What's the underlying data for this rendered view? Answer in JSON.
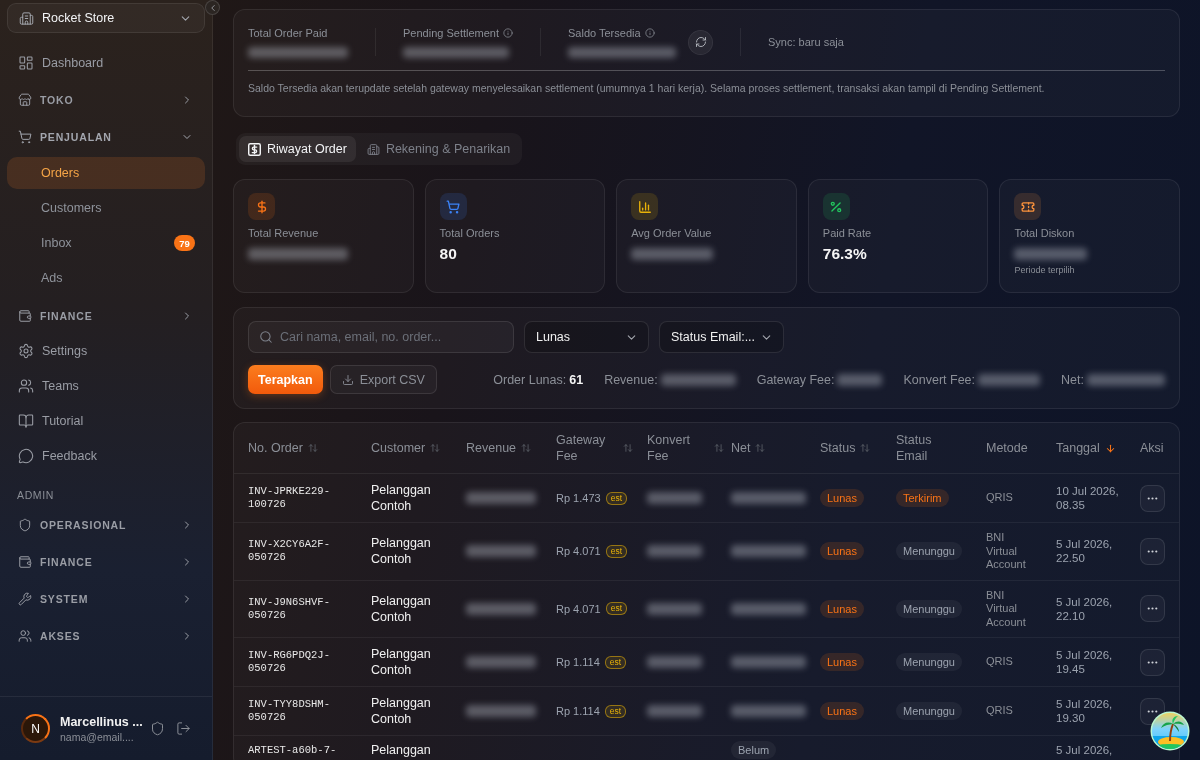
{
  "sidebar": {
    "store": {
      "name": "Rocket Store"
    },
    "items": [
      {
        "kind": "link",
        "label": "Dashboard",
        "selected": false
      },
      {
        "kind": "group",
        "label": "TOKO",
        "expanded": false
      },
      {
        "kind": "group",
        "label": "PENJUALAN",
        "expanded": true,
        "children": [
          {
            "label": "Orders",
            "selected": true
          },
          {
            "label": "Customers",
            "selected": false
          },
          {
            "label": "Inbox",
            "selected": false,
            "badge": "79"
          },
          {
            "label": "Ads",
            "selected": false
          }
        ]
      },
      {
        "kind": "group",
        "label": "FINANCE",
        "expanded": false
      },
      {
        "kind": "link",
        "label": "Settings",
        "selected": false
      },
      {
        "kind": "link",
        "label": "Teams",
        "selected": false
      },
      {
        "kind": "link",
        "label": "Tutorial",
        "selected": false
      },
      {
        "kind": "link",
        "label": "Feedback",
        "selected": false
      },
      {
        "kind": "heading",
        "label": "ADMIN"
      },
      {
        "kind": "group",
        "label": "OPERASIONAL",
        "expanded": false
      },
      {
        "kind": "group",
        "label": "FINANCE",
        "expanded": false
      },
      {
        "kind": "group",
        "label": "SYSTEM",
        "expanded": false
      },
      {
        "kind": "group",
        "label": "AKSES",
        "expanded": false
      }
    ],
    "user": {
      "initial": "N",
      "name": "Marcellinus ...",
      "email": "nama@email...."
    }
  },
  "settlement": {
    "stats": [
      {
        "label": "Total Order Paid",
        "info": false,
        "blurred": true
      },
      {
        "label": "Pending Settlement",
        "info": true,
        "blurred": true
      },
      {
        "label": "Saldo Tersedia",
        "info": true,
        "blurred": true
      }
    ],
    "sync": "Sync: baru saja",
    "note": "Saldo Tersedia akan terupdate setelah gateway menyelesaikan settlement (umumnya 1 hari kerja). Selama proses settlement, transaksi akan tampil di Pending Settlement."
  },
  "tabs": [
    {
      "label": "Riwayat Order",
      "selected": true
    },
    {
      "label": "Rekening & Penarikan",
      "selected": false
    }
  ],
  "stat_cards": [
    {
      "label": "Total Revenue",
      "blurred": true,
      "color": "#f97316"
    },
    {
      "label": "Total Orders",
      "value": "80",
      "color": "#3b82f6"
    },
    {
      "label": "Avg Order Value",
      "blurred": true,
      "color": "#eab308"
    },
    {
      "label": "Paid Rate",
      "value": "76.3%",
      "color": "#22c55e"
    },
    {
      "label": "Total Diskon",
      "blurred": true,
      "note": "Periode terpilih",
      "color": "#fb923c"
    }
  ],
  "filters": {
    "search": {
      "placeholder": "Cari nama, email, no. order..."
    },
    "selects": [
      {
        "value": "Lunas"
      },
      {
        "value": "Status Email:..."
      }
    ],
    "apply": "Terapkan",
    "export": "Export CSV",
    "summary": [
      {
        "label": "Order Lunas:",
        "value": "61"
      },
      {
        "label": "Revenue:",
        "blurred": true
      },
      {
        "label": "Gateway Fee:",
        "blurred": true
      },
      {
        "label": "Konvert Fee:",
        "blurred": true
      },
      {
        "label": "Net:",
        "blurred": true
      }
    ]
  },
  "table": {
    "columns": [
      {
        "label": "No. Order",
        "sortable": true,
        "sorted": false
      },
      {
        "label": "Customer",
        "sortable": true,
        "sorted": false
      },
      {
        "label": "Revenue",
        "sortable": true,
        "sorted": false
      },
      {
        "label": "Gateway Fee",
        "sortable": true,
        "sorted": false
      },
      {
        "label": "Konvert Fee",
        "sortable": true,
        "sorted": false
      },
      {
        "label": "Net",
        "sortable": true,
        "sorted": false
      },
      {
        "label": "Status",
        "sortable": true,
        "sorted": false
      },
      {
        "label": "Status Email",
        "sortable": false
      },
      {
        "label": "Metode",
        "sortable": false
      },
      {
        "label": "Tanggal",
        "sortable": true,
        "sorted": true
      },
      {
        "label": "Aksi",
        "sortable": false
      }
    ],
    "rows": [
      {
        "order": "INV-JPRKE229-100726",
        "customer": "Pelanggan Contoh",
        "revenue": {
          "blurred": true
        },
        "gateway_fee": {
          "text": "Rp 1.473",
          "tag": "est"
        },
        "konvert_fee": {
          "blurred": true
        },
        "net": {
          "blurred": true
        },
        "status": {
          "label": "Lunas",
          "kind": "paid"
        },
        "status_email": {
          "label": "Terkirim",
          "kind": "sent"
        },
        "method": "QRIS",
        "date": "10 Jul 2026, 08.35",
        "actions": true
      },
      {
        "order": "INV-X2CY6A2F-050726",
        "customer": "Pelanggan Contoh",
        "revenue": {
          "blurred": true
        },
        "gateway_fee": {
          "text": "Rp 4.071",
          "tag": "est"
        },
        "konvert_fee": {
          "blurred": true
        },
        "net": {
          "blurred": true
        },
        "status": {
          "label": "Lunas",
          "kind": "paid"
        },
        "status_email": {
          "label": "Menunggu",
          "kind": "waiting"
        },
        "method": "BNI Virtual Account",
        "date": "5 Jul 2026, 22.50",
        "actions": true
      },
      {
        "order": "INV-J9N6SHVF-050726",
        "customer": "Pelanggan Contoh",
        "revenue": {
          "blurred": true
        },
        "gateway_fee": {
          "text": "Rp 4.071",
          "tag": "est"
        },
        "konvert_fee": {
          "blurred": true
        },
        "net": {
          "blurred": true
        },
        "status": {
          "label": "Lunas",
          "kind": "paid"
        },
        "status_email": {
          "label": "Menunggu",
          "kind": "waiting"
        },
        "method": "BNI Virtual Account",
        "date": "5 Jul 2026, 22.10",
        "actions": true
      },
      {
        "order": "INV-RG6PDQ2J-050726",
        "customer": "Pelanggan Contoh",
        "revenue": {
          "blurred": true
        },
        "gateway_fee": {
          "text": "Rp 1.114",
          "tag": "est"
        },
        "konvert_fee": {
          "blurred": true
        },
        "net": {
          "blurred": true
        },
        "status": {
          "label": "Lunas",
          "kind": "paid"
        },
        "status_email": {
          "label": "Menunggu",
          "kind": "waiting"
        },
        "method": "QRIS",
        "date": "5 Jul 2026, 19.45",
        "actions": true
      },
      {
        "order": "INV-TYY8DSHM-050726",
        "customer": "Pelanggan Contoh",
        "revenue": {
          "blurred": true
        },
        "gateway_fee": {
          "text": "Rp 1.114",
          "tag": "est"
        },
        "konvert_fee": {
          "blurred": true
        },
        "net": {
          "blurred": true
        },
        "status": {
          "label": "Lunas",
          "kind": "paid"
        },
        "status_email": {
          "label": "Menunggu",
          "kind": "waiting"
        },
        "method": "QRIS",
        "date": "5 Jul 2026, 19.30",
        "actions": true
      },
      {
        "order": "ARTEST-a60b-7-",
        "customer": "Pelanggan",
        "net": {
          "badge": "Belum"
        },
        "date": "5 Jul 2026,",
        "actions": false
      }
    ]
  }
}
